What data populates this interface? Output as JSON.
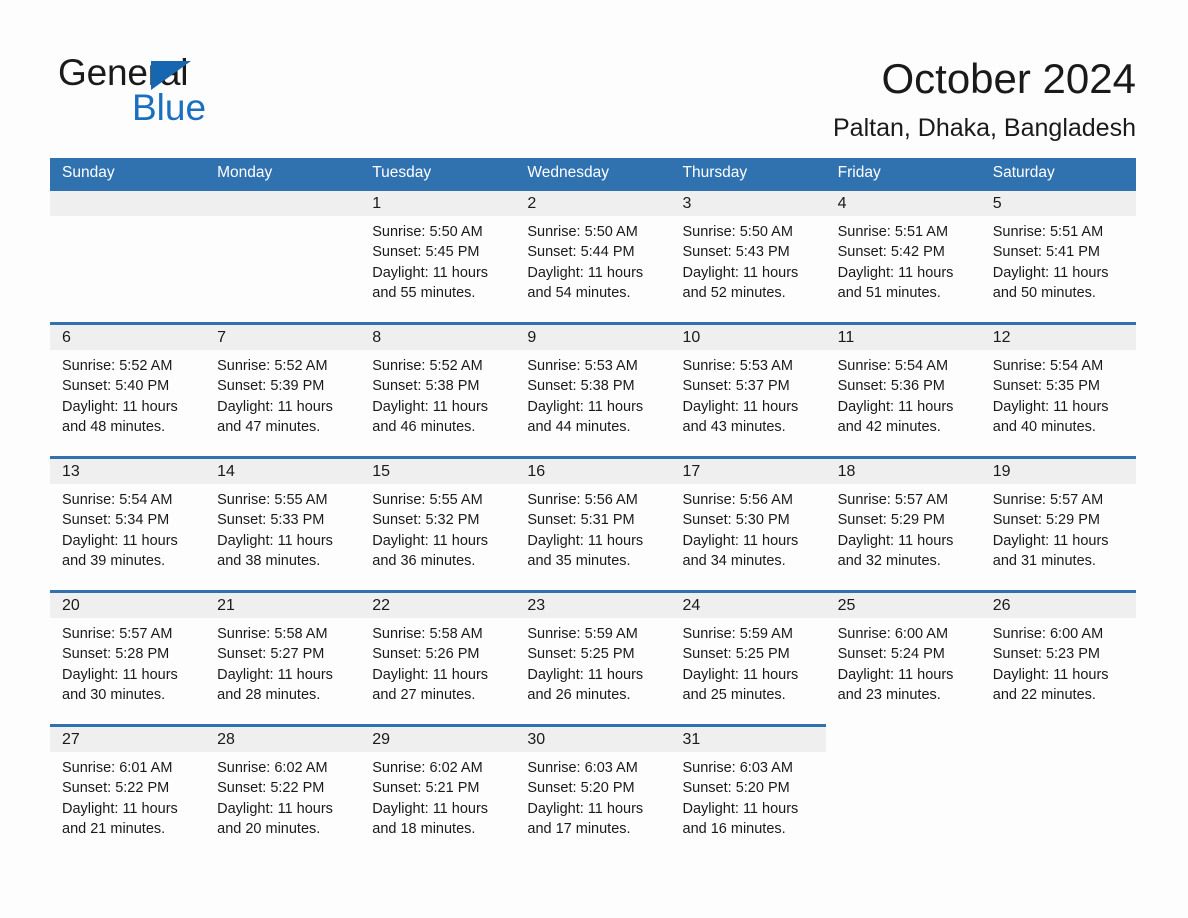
{
  "logo": {
    "word_one": "General",
    "word_two": "Blue",
    "triangle_color": "#1667b0",
    "blue_text_color": "#1a6fc0"
  },
  "header": {
    "title": "October 2024",
    "location": "Paltan, Dhaka, Bangladesh",
    "accent_color": "#3072b0",
    "daynum_band_color": "#efefef"
  },
  "weekday_headers": [
    "Sunday",
    "Monday",
    "Tuesday",
    "Wednesday",
    "Thursday",
    "Friday",
    "Saturday"
  ],
  "labels": {
    "sunrise_prefix": "Sunrise:",
    "sunset_prefix": "Sunset:",
    "daylight_prefix": "Daylight:"
  },
  "weeks": [
    [
      {
        "kind": "empty"
      },
      {
        "kind": "empty"
      },
      {
        "kind": "day",
        "date": "1",
        "sunrise_line": "Sunrise: 5:50 AM",
        "sunset_line": "Sunset: 5:45 PM",
        "daylight_line_1": "Daylight: 11 hours",
        "daylight_line_2": "and 55 minutes."
      },
      {
        "kind": "day",
        "date": "2",
        "sunrise_line": "Sunrise: 5:50 AM",
        "sunset_line": "Sunset: 5:44 PM",
        "daylight_line_1": "Daylight: 11 hours",
        "daylight_line_2": "and 54 minutes."
      },
      {
        "kind": "day",
        "date": "3",
        "sunrise_line": "Sunrise: 5:50 AM",
        "sunset_line": "Sunset: 5:43 PM",
        "daylight_line_1": "Daylight: 11 hours",
        "daylight_line_2": "and 52 minutes."
      },
      {
        "kind": "day",
        "date": "4",
        "sunrise_line": "Sunrise: 5:51 AM",
        "sunset_line": "Sunset: 5:42 PM",
        "daylight_line_1": "Daylight: 11 hours",
        "daylight_line_2": "and 51 minutes."
      },
      {
        "kind": "day",
        "date": "5",
        "sunrise_line": "Sunrise: 5:51 AM",
        "sunset_line": "Sunset: 5:41 PM",
        "daylight_line_1": "Daylight: 11 hours",
        "daylight_line_2": "and 50 minutes."
      }
    ],
    [
      {
        "kind": "day",
        "date": "6",
        "sunrise_line": "Sunrise: 5:52 AM",
        "sunset_line": "Sunset: 5:40 PM",
        "daylight_line_1": "Daylight: 11 hours",
        "daylight_line_2": "and 48 minutes."
      },
      {
        "kind": "day",
        "date": "7",
        "sunrise_line": "Sunrise: 5:52 AM",
        "sunset_line": "Sunset: 5:39 PM",
        "daylight_line_1": "Daylight: 11 hours",
        "daylight_line_2": "and 47 minutes."
      },
      {
        "kind": "day",
        "date": "8",
        "sunrise_line": "Sunrise: 5:52 AM",
        "sunset_line": "Sunset: 5:38 PM",
        "daylight_line_1": "Daylight: 11 hours",
        "daylight_line_2": "and 46 minutes."
      },
      {
        "kind": "day",
        "date": "9",
        "sunrise_line": "Sunrise: 5:53 AM",
        "sunset_line": "Sunset: 5:38 PM",
        "daylight_line_1": "Daylight: 11 hours",
        "daylight_line_2": "and 44 minutes."
      },
      {
        "kind": "day",
        "date": "10",
        "sunrise_line": "Sunrise: 5:53 AM",
        "sunset_line": "Sunset: 5:37 PM",
        "daylight_line_1": "Daylight: 11 hours",
        "daylight_line_2": "and 43 minutes."
      },
      {
        "kind": "day",
        "date": "11",
        "sunrise_line": "Sunrise: 5:54 AM",
        "sunset_line": "Sunset: 5:36 PM",
        "daylight_line_1": "Daylight: 11 hours",
        "daylight_line_2": "and 42 minutes."
      },
      {
        "kind": "day",
        "date": "12",
        "sunrise_line": "Sunrise: 5:54 AM",
        "sunset_line": "Sunset: 5:35 PM",
        "daylight_line_1": "Daylight: 11 hours",
        "daylight_line_2": "and 40 minutes."
      }
    ],
    [
      {
        "kind": "day",
        "date": "13",
        "sunrise_line": "Sunrise: 5:54 AM",
        "sunset_line": "Sunset: 5:34 PM",
        "daylight_line_1": "Daylight: 11 hours",
        "daylight_line_2": "and 39 minutes."
      },
      {
        "kind": "day",
        "date": "14",
        "sunrise_line": "Sunrise: 5:55 AM",
        "sunset_line": "Sunset: 5:33 PM",
        "daylight_line_1": "Daylight: 11 hours",
        "daylight_line_2": "and 38 minutes."
      },
      {
        "kind": "day",
        "date": "15",
        "sunrise_line": "Sunrise: 5:55 AM",
        "sunset_line": "Sunset: 5:32 PM",
        "daylight_line_1": "Daylight: 11 hours",
        "daylight_line_2": "and 36 minutes."
      },
      {
        "kind": "day",
        "date": "16",
        "sunrise_line": "Sunrise: 5:56 AM",
        "sunset_line": "Sunset: 5:31 PM",
        "daylight_line_1": "Daylight: 11 hours",
        "daylight_line_2": "and 35 minutes."
      },
      {
        "kind": "day",
        "date": "17",
        "sunrise_line": "Sunrise: 5:56 AM",
        "sunset_line": "Sunset: 5:30 PM",
        "daylight_line_1": "Daylight: 11 hours",
        "daylight_line_2": "and 34 minutes."
      },
      {
        "kind": "day",
        "date": "18",
        "sunrise_line": "Sunrise: 5:57 AM",
        "sunset_line": "Sunset: 5:29 PM",
        "daylight_line_1": "Daylight: 11 hours",
        "daylight_line_2": "and 32 minutes."
      },
      {
        "kind": "day",
        "date": "19",
        "sunrise_line": "Sunrise: 5:57 AM",
        "sunset_line": "Sunset: 5:29 PM",
        "daylight_line_1": "Daylight: 11 hours",
        "daylight_line_2": "and 31 minutes."
      }
    ],
    [
      {
        "kind": "day",
        "date": "20",
        "sunrise_line": "Sunrise: 5:57 AM",
        "sunset_line": "Sunset: 5:28 PM",
        "daylight_line_1": "Daylight: 11 hours",
        "daylight_line_2": "and 30 minutes."
      },
      {
        "kind": "day",
        "date": "21",
        "sunrise_line": "Sunrise: 5:58 AM",
        "sunset_line": "Sunset: 5:27 PM",
        "daylight_line_1": "Daylight: 11 hours",
        "daylight_line_2": "and 28 minutes."
      },
      {
        "kind": "day",
        "date": "22",
        "sunrise_line": "Sunrise: 5:58 AM",
        "sunset_line": "Sunset: 5:26 PM",
        "daylight_line_1": "Daylight: 11 hours",
        "daylight_line_2": "and 27 minutes."
      },
      {
        "kind": "day",
        "date": "23",
        "sunrise_line": "Sunrise: 5:59 AM",
        "sunset_line": "Sunset: 5:25 PM",
        "daylight_line_1": "Daylight: 11 hours",
        "daylight_line_2": "and 26 minutes."
      },
      {
        "kind": "day",
        "date": "24",
        "sunrise_line": "Sunrise: 5:59 AM",
        "sunset_line": "Sunset: 5:25 PM",
        "daylight_line_1": "Daylight: 11 hours",
        "daylight_line_2": "and 25 minutes."
      },
      {
        "kind": "day",
        "date": "25",
        "sunrise_line": "Sunrise: 6:00 AM",
        "sunset_line": "Sunset: 5:24 PM",
        "daylight_line_1": "Daylight: 11 hours",
        "daylight_line_2": "and 23 minutes."
      },
      {
        "kind": "day",
        "date": "26",
        "sunrise_line": "Sunrise: 6:00 AM",
        "sunset_line": "Sunset: 5:23 PM",
        "daylight_line_1": "Daylight: 11 hours",
        "daylight_line_2": "and 22 minutes."
      }
    ],
    [
      {
        "kind": "day",
        "date": "27",
        "sunrise_line": "Sunrise: 6:01 AM",
        "sunset_line": "Sunset: 5:22 PM",
        "daylight_line_1": "Daylight: 11 hours",
        "daylight_line_2": "and 21 minutes."
      },
      {
        "kind": "day",
        "date": "28",
        "sunrise_line": "Sunrise: 6:02 AM",
        "sunset_line": "Sunset: 5:22 PM",
        "daylight_line_1": "Daylight: 11 hours",
        "daylight_line_2": "and 20 minutes."
      },
      {
        "kind": "day",
        "date": "29",
        "sunrise_line": "Sunrise: 6:02 AM",
        "sunset_line": "Sunset: 5:21 PM",
        "daylight_line_1": "Daylight: 11 hours",
        "daylight_line_2": "and 18 minutes."
      },
      {
        "kind": "day",
        "date": "30",
        "sunrise_line": "Sunrise: 6:03 AM",
        "sunset_line": "Sunset: 5:20 PM",
        "daylight_line_1": "Daylight: 11 hours",
        "daylight_line_2": "and 17 minutes."
      },
      {
        "kind": "day",
        "date": "31",
        "sunrise_line": "Sunrise: 6:03 AM",
        "sunset_line": "Sunset: 5:20 PM",
        "daylight_line_1": "Daylight: 11 hours",
        "daylight_line_2": "and 16 minutes."
      },
      {
        "kind": "blank"
      },
      {
        "kind": "blank"
      }
    ]
  ]
}
